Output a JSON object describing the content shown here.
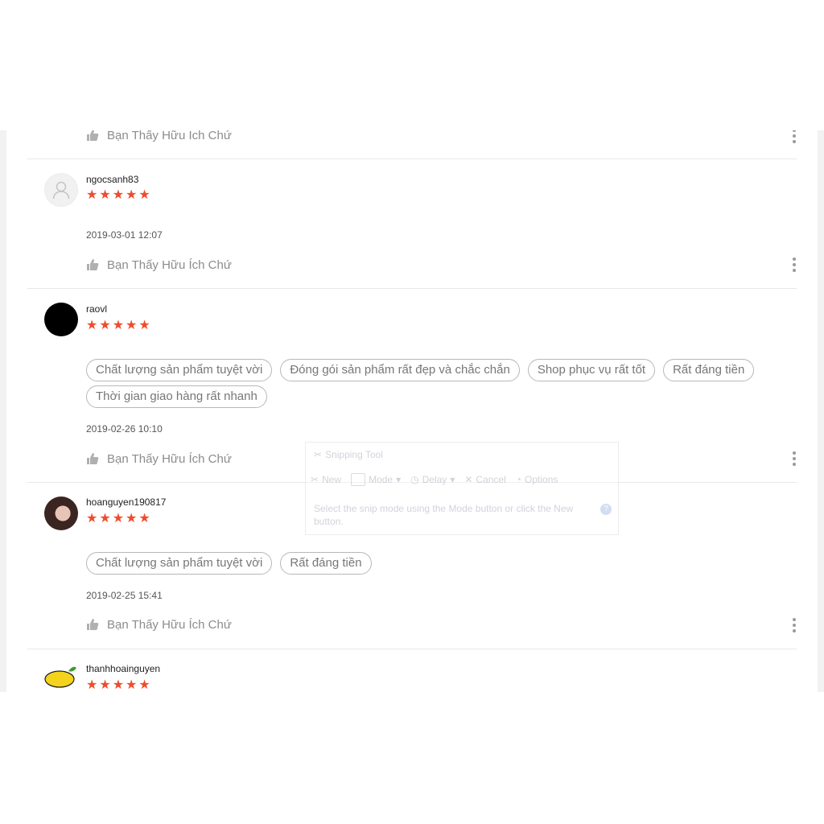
{
  "helpful_label": "Bạn Thấy Hữu Ích Chứ",
  "reviews": [
    {
      "username": "ngocsanh83",
      "rating": 5,
      "stars": "★★★★★",
      "tags": [],
      "date": "2019-03-01 12:07"
    },
    {
      "username": "raovl",
      "rating": 5,
      "stars": "★★★★★",
      "tags": [
        "Chất lượng sản phẩm tuyệt vời",
        "Đóng gói sản phẩm rất đẹp và chắc chắn",
        "Shop phục vụ rất tốt",
        "Rất đáng tiền",
        "Thời gian giao hàng rất nhanh"
      ],
      "date": "2019-02-26 10:10"
    },
    {
      "username": "hoanguyen190817",
      "rating": 5,
      "stars": "★★★★★",
      "tags": [
        "Chất lượng sản phẩm tuyệt vời",
        "Rất đáng tiền"
      ],
      "date": "2019-02-25 15:41"
    },
    {
      "username": "thanhhoainguyen",
      "rating": 5,
      "stars": "★★★★★",
      "tags": [],
      "date": ""
    }
  ],
  "snipping_tool": {
    "title": "Snipping Tool",
    "new_label": "New",
    "mode_label": "Mode",
    "delay_label": "Delay",
    "cancel_label": "Cancel",
    "options_label": "Options",
    "message": "Select the snip mode using the Mode button or click the New button."
  },
  "colors": {
    "star": "#ee4d2d",
    "muted_text": "#8c8c8c",
    "divider": "#e8e8e8"
  },
  "icons": [
    "thumbs-up-icon",
    "more-vertical-icon",
    "user-avatar-icon",
    "star-icon",
    "help-icon"
  ]
}
